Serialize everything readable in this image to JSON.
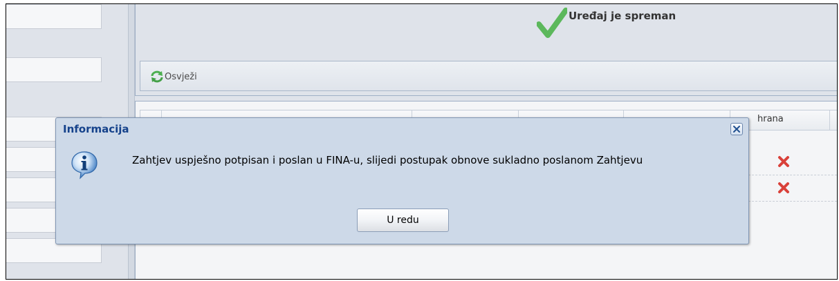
{
  "status": {
    "icon": "check-icon",
    "text": "Uređaj je spreman"
  },
  "toolbar": {
    "refresh_icon": "refresh-icon",
    "refresh_label": "Osvježi"
  },
  "grid": {
    "visible_header": "hrana",
    "rows": [
      {
        "action_icon": "delete-icon"
      },
      {
        "action_icon": "delete-icon"
      }
    ]
  },
  "dialog": {
    "title": "Informacija",
    "icon": "info-icon",
    "message": "Zahtjev uspješno potpisan i poslan u FINA-u, slijedi postupak obnove sukladno poslanom Zahtjevu",
    "ok_label": "U redu",
    "close_icon": "close-icon"
  },
  "colors": {
    "dialog_title": "#15428b",
    "dialog_background": "#cdd9e8",
    "panel_background": "#dfe3ea",
    "success_check": "#4caf50",
    "delete_red": "#d32f2f"
  }
}
